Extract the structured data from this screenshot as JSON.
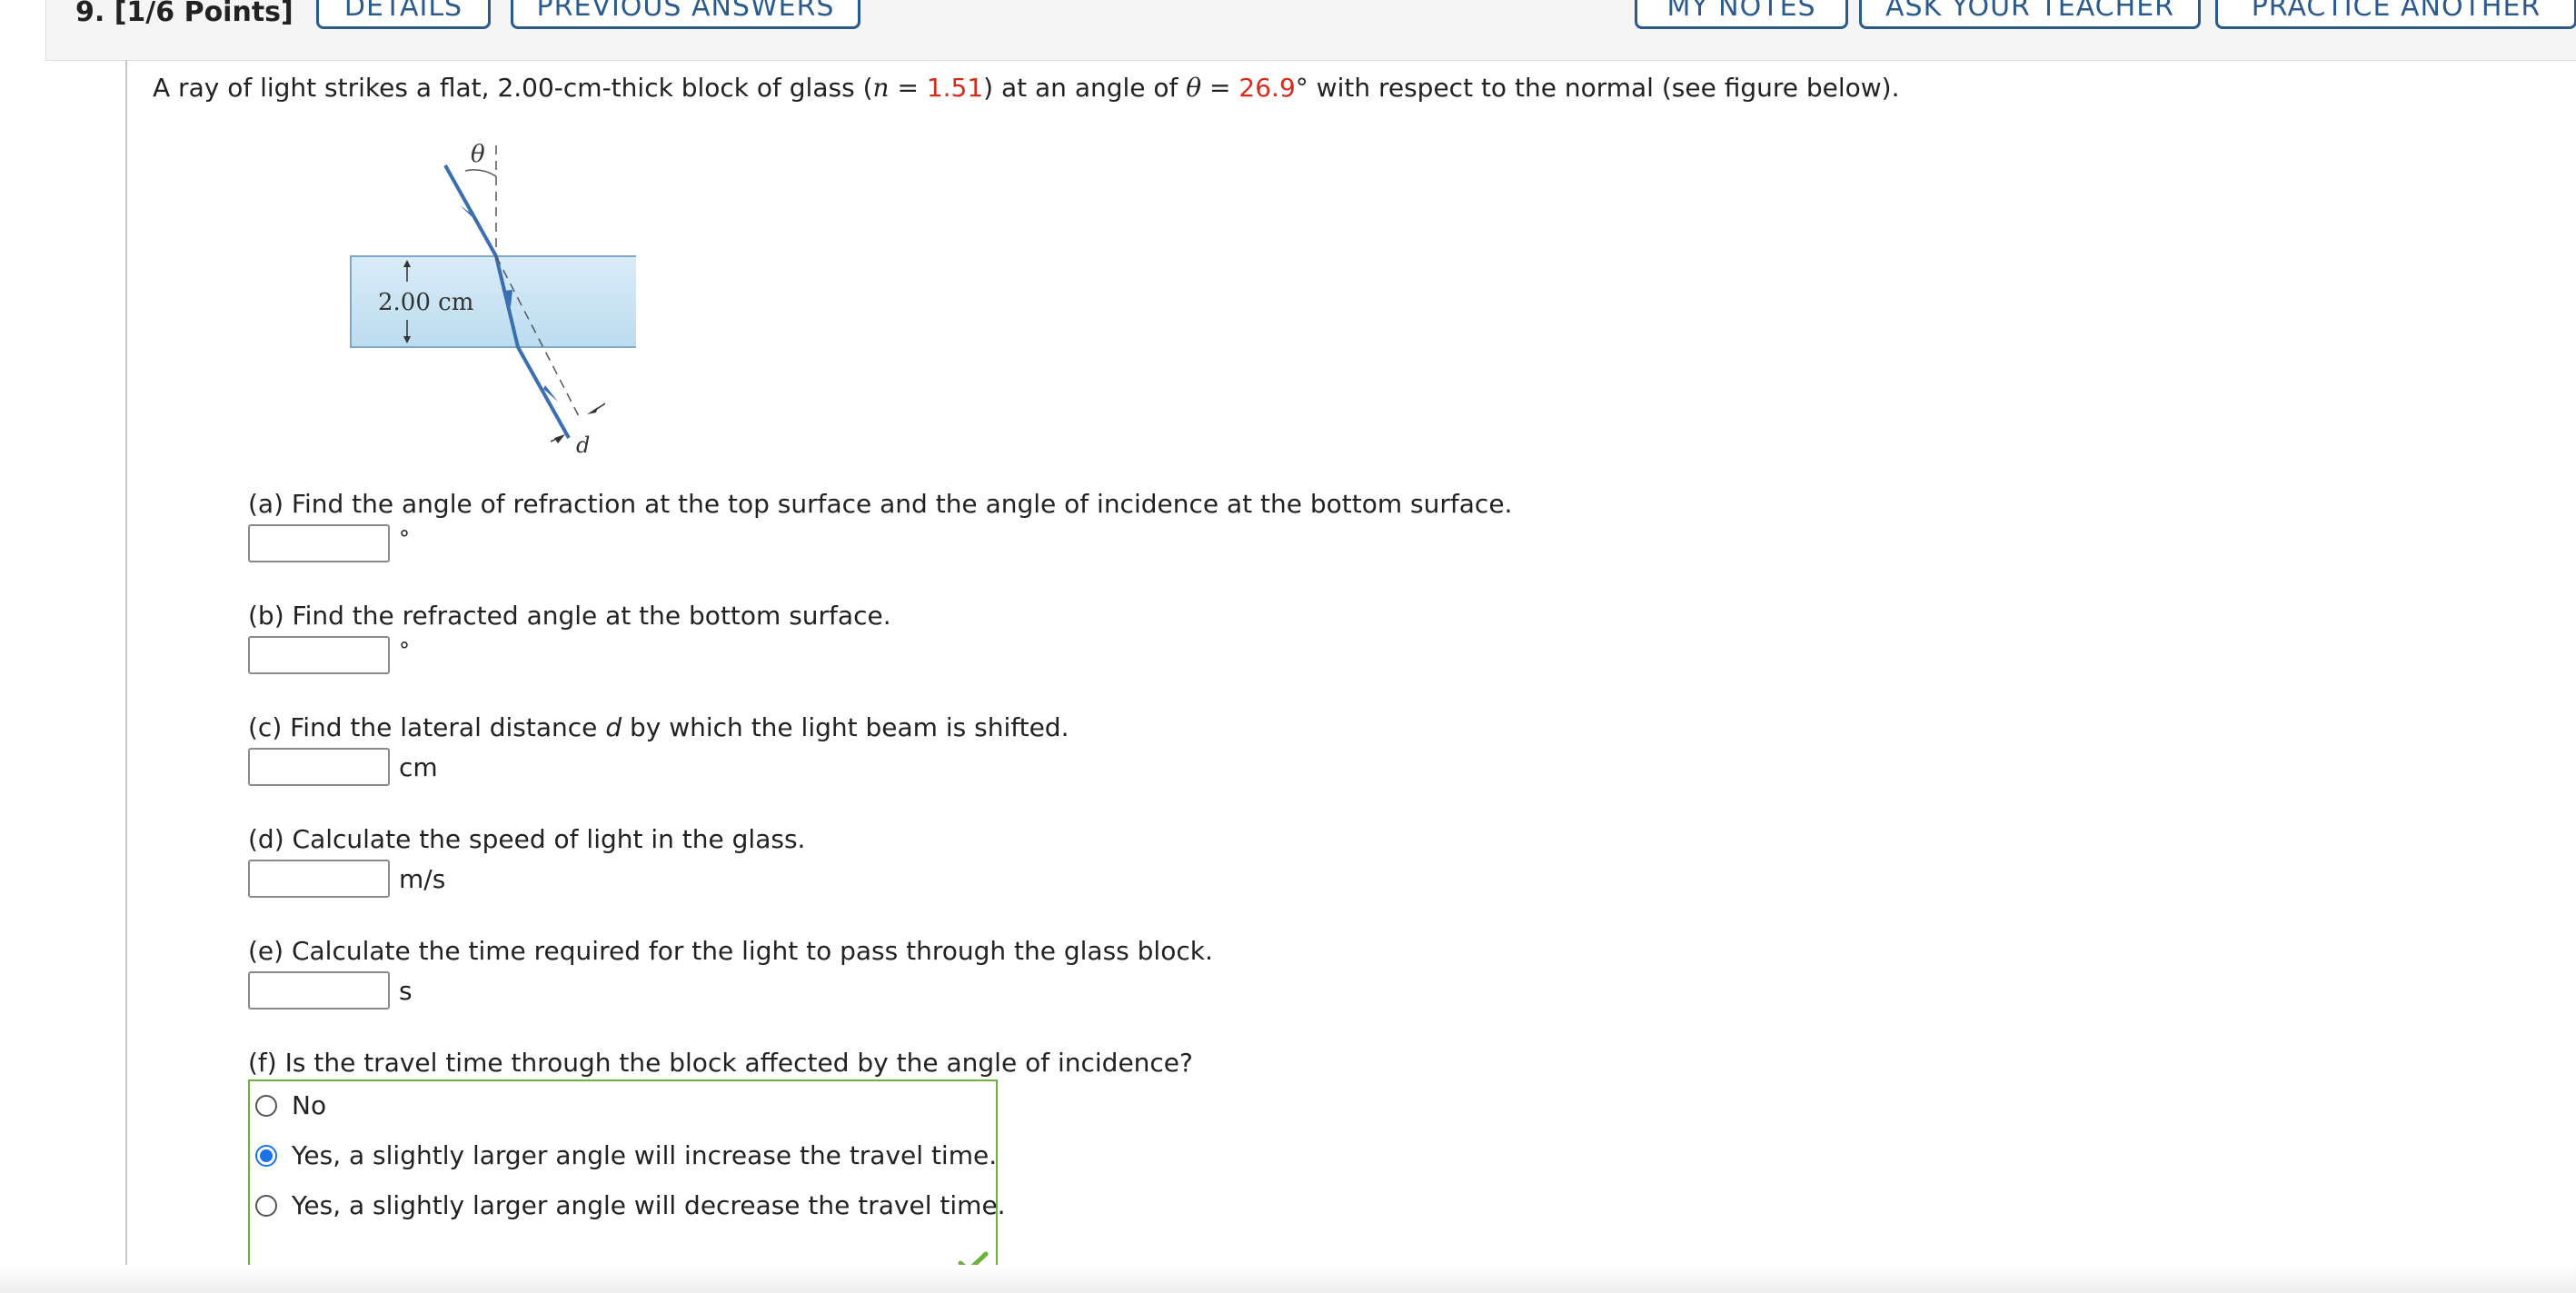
{
  "header": {
    "question_label": "9.  [1/6 Points]",
    "buttons": {
      "details": "DETAILS",
      "previous_answers": "PREVIOUS ANSWERS",
      "my_notes": "MY NOTES",
      "ask_teacher": "ASK YOUR TEACHER",
      "practice_another": "PRACTICE ANOTHER"
    }
  },
  "problem": {
    "intro_1": "A ray of light strikes a flat, 2.00-cm-thick block of glass (",
    "n_symbol": "n",
    "eq1": " = ",
    "n_value": "1.51",
    "intro_2": ") at an angle of ",
    "theta_symbol": "θ",
    "eq2": " = ",
    "theta_value": "26.9",
    "intro_3": "° with respect to the normal (see figure below)."
  },
  "figure": {
    "theta_label": "θ",
    "thickness_label": "2.00 cm",
    "d_label": "d"
  },
  "parts": {
    "a": {
      "text": "(a) Find the angle of refraction at the top surface and the angle of incidence at the bottom surface.",
      "unit": "°",
      "value": ""
    },
    "b": {
      "text": "(b) Find the refracted angle at the bottom surface.",
      "unit": "°",
      "value": ""
    },
    "c": {
      "text_pre": "(c) Find the lateral distance ",
      "text_var": "d",
      "text_post": " by which the light beam is shifted.",
      "unit": "cm",
      "value": ""
    },
    "d": {
      "text": "(d) Calculate the speed of light in the glass.",
      "unit": "m/s",
      "value": ""
    },
    "e": {
      "text": "(e) Calculate the time required for the light to pass through the glass block.",
      "unit": "s",
      "value": ""
    },
    "f": {
      "text": "(f) Is the travel time through the block affected by the angle of incidence?",
      "options": [
        "No",
        "Yes, a slightly larger angle will increase the travel time.",
        "Yes, a slightly larger angle will decrease the travel time."
      ],
      "selected_index": 1,
      "status": "correct"
    }
  },
  "colors": {
    "button_blue": "#2b5b8c",
    "given_red": "#d52d1c",
    "correct_green": "#6cb33e",
    "ray_blue": "#3a6fb0",
    "glass_fill": "#cfe6f5"
  }
}
